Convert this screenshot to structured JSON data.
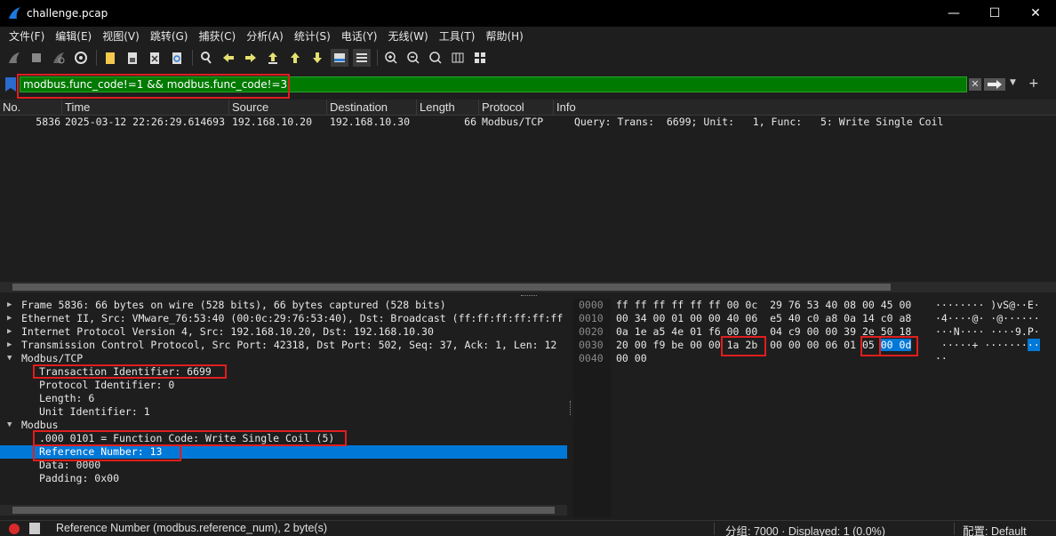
{
  "window": {
    "title": "challenge.pcap",
    "minimize": "—",
    "maximize": "☐",
    "close": "✕"
  },
  "menu": [
    "文件(F)",
    "编辑(E)",
    "视图(V)",
    "跳转(G)",
    "捕获(C)",
    "分析(A)",
    "统计(S)",
    "电话(Y)",
    "无线(W)",
    "工具(T)",
    "帮助(H)"
  ],
  "filter": {
    "value": "modbus.func_code!=1 && modbus.func_code!=3",
    "clear": "✕",
    "add": "+"
  },
  "packet_list": {
    "columns": [
      "No.",
      "Time",
      "Source",
      "Destination",
      "Length",
      "Protocol",
      "Info"
    ],
    "rows": [
      {
        "no": "5836",
        "time": "2025-03-12 22:26:29.614693",
        "source": "192.168.10.20",
        "destination": "192.168.10.30",
        "length": "66",
        "protocol": "Modbus/TCP",
        "info": "Query: Trans:  6699; Unit:   1, Func:   5: Write Single Coil"
      }
    ]
  },
  "details": {
    "frame": "Frame 5836: 66 bytes on wire (528 bits), 66 bytes captured (528 bits)",
    "ethernet": "Ethernet II, Src: VMware_76:53:40 (00:0c:29:76:53:40), Dst: Broadcast (ff:ff:ff:ff:ff:ff",
    "ip": "Internet Protocol Version 4, Src: 192.168.10.20, Dst: 192.168.10.30",
    "tcp": "Transmission Control Protocol, Src Port: 42318, Dst Port: 502, Seq: 37, Ack: 1, Len: 12",
    "modbus_tcp": "Modbus/TCP",
    "transaction_id": "Transaction Identifier: 6699",
    "protocol_id": "Protocol Identifier: 0",
    "length": "Length: 6",
    "unit_id": "Unit Identifier: 1",
    "modbus": "Modbus",
    "func_code": ".000 0101 = Function Code: Write Single Coil (5)",
    "reference_number": "Reference Number: 13",
    "data": "Data: 0000",
    "padding": "Padding: 0x00"
  },
  "bytes": {
    "offsets": [
      "0000",
      "0010",
      "0020",
      "0030",
      "0040"
    ],
    "line0": {
      "hex": "ff ff ff ff ff ff 00 0c  29 76 53 40 08 00 45 00",
      "ascii": "········ )vS@··E·"
    },
    "line1": {
      "hex": "00 34 00 01 00 00 40 06  e5 40 c0 a8 0a 14 c0 a8",
      "ascii": "·4····@· ·@······"
    },
    "line2": {
      "hex": "0a 1e a5 4e 01 f6 00 00  04 c9 00 00 39 2e 50 18",
      "ascii": "···N···· ····9.P·"
    },
    "line3": {
      "hex_a": "20 00 f9 be 00 00 ",
      "hex_b": "1a 2b",
      "hex_c": "  00 00 00 06 01 ",
      "hex_d": "05",
      "hex_e": " ",
      "hex_f": "00 0d",
      "ascii_a": " ·····+ ·······",
      "ascii_b": "··"
    },
    "line4": {
      "hex": "00 00",
      "ascii": "··"
    }
  },
  "status": {
    "field": "Reference Number (modbus.reference_num), 2 byte(s)",
    "packets": "分组: 7000 · Displayed: 1 (0.0%)",
    "profile": "配置: Default"
  }
}
